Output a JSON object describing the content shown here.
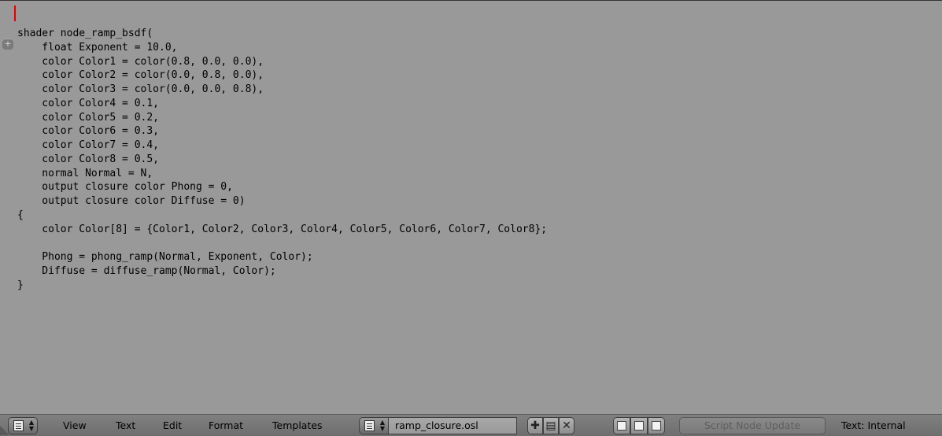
{
  "editor": {
    "code_lines": [
      "shader node_ramp_bsdf(",
      "    float Exponent = 10.0,",
      "    color Color1 = color(0.8, 0.0, 0.0),",
      "    color Color2 = color(0.0, 0.8, 0.0),",
      "    color Color3 = color(0.0, 0.0, 0.8),",
      "    color Color4 = 0.1,",
      "    color Color5 = 0.2,",
      "    color Color6 = 0.3,",
      "    color Color7 = 0.4,",
      "    color Color8 = 0.5,",
      "    normal Normal = N,",
      "    output closure color Phong = 0,",
      "    output closure color Diffuse = 0)",
      "{",
      "    color Color[8] = {Color1, Color2, Color3, Color4, Color5, Color6, Color7, Color8};",
      "",
      "    Phong = phong_ramp(Normal, Exponent, Color);",
      "    Diffuse = diffuse_ramp(Normal, Color);",
      "}"
    ],
    "background_color": "#999999",
    "cursor_color": "#e00000"
  },
  "header": {
    "menus": [
      "View",
      "Text",
      "Edit",
      "Format",
      "Templates"
    ],
    "text_name": "ramp_closure.osl",
    "tool_icons": [
      "new-text-icon",
      "open-text-icon",
      "unlink-text-icon"
    ],
    "toggle_icons": [
      "line-numbers-icon",
      "word-wrap-icon",
      "syntax-highlight-icon"
    ],
    "script_button": "Script Node Update",
    "status": "Text: Internal"
  }
}
